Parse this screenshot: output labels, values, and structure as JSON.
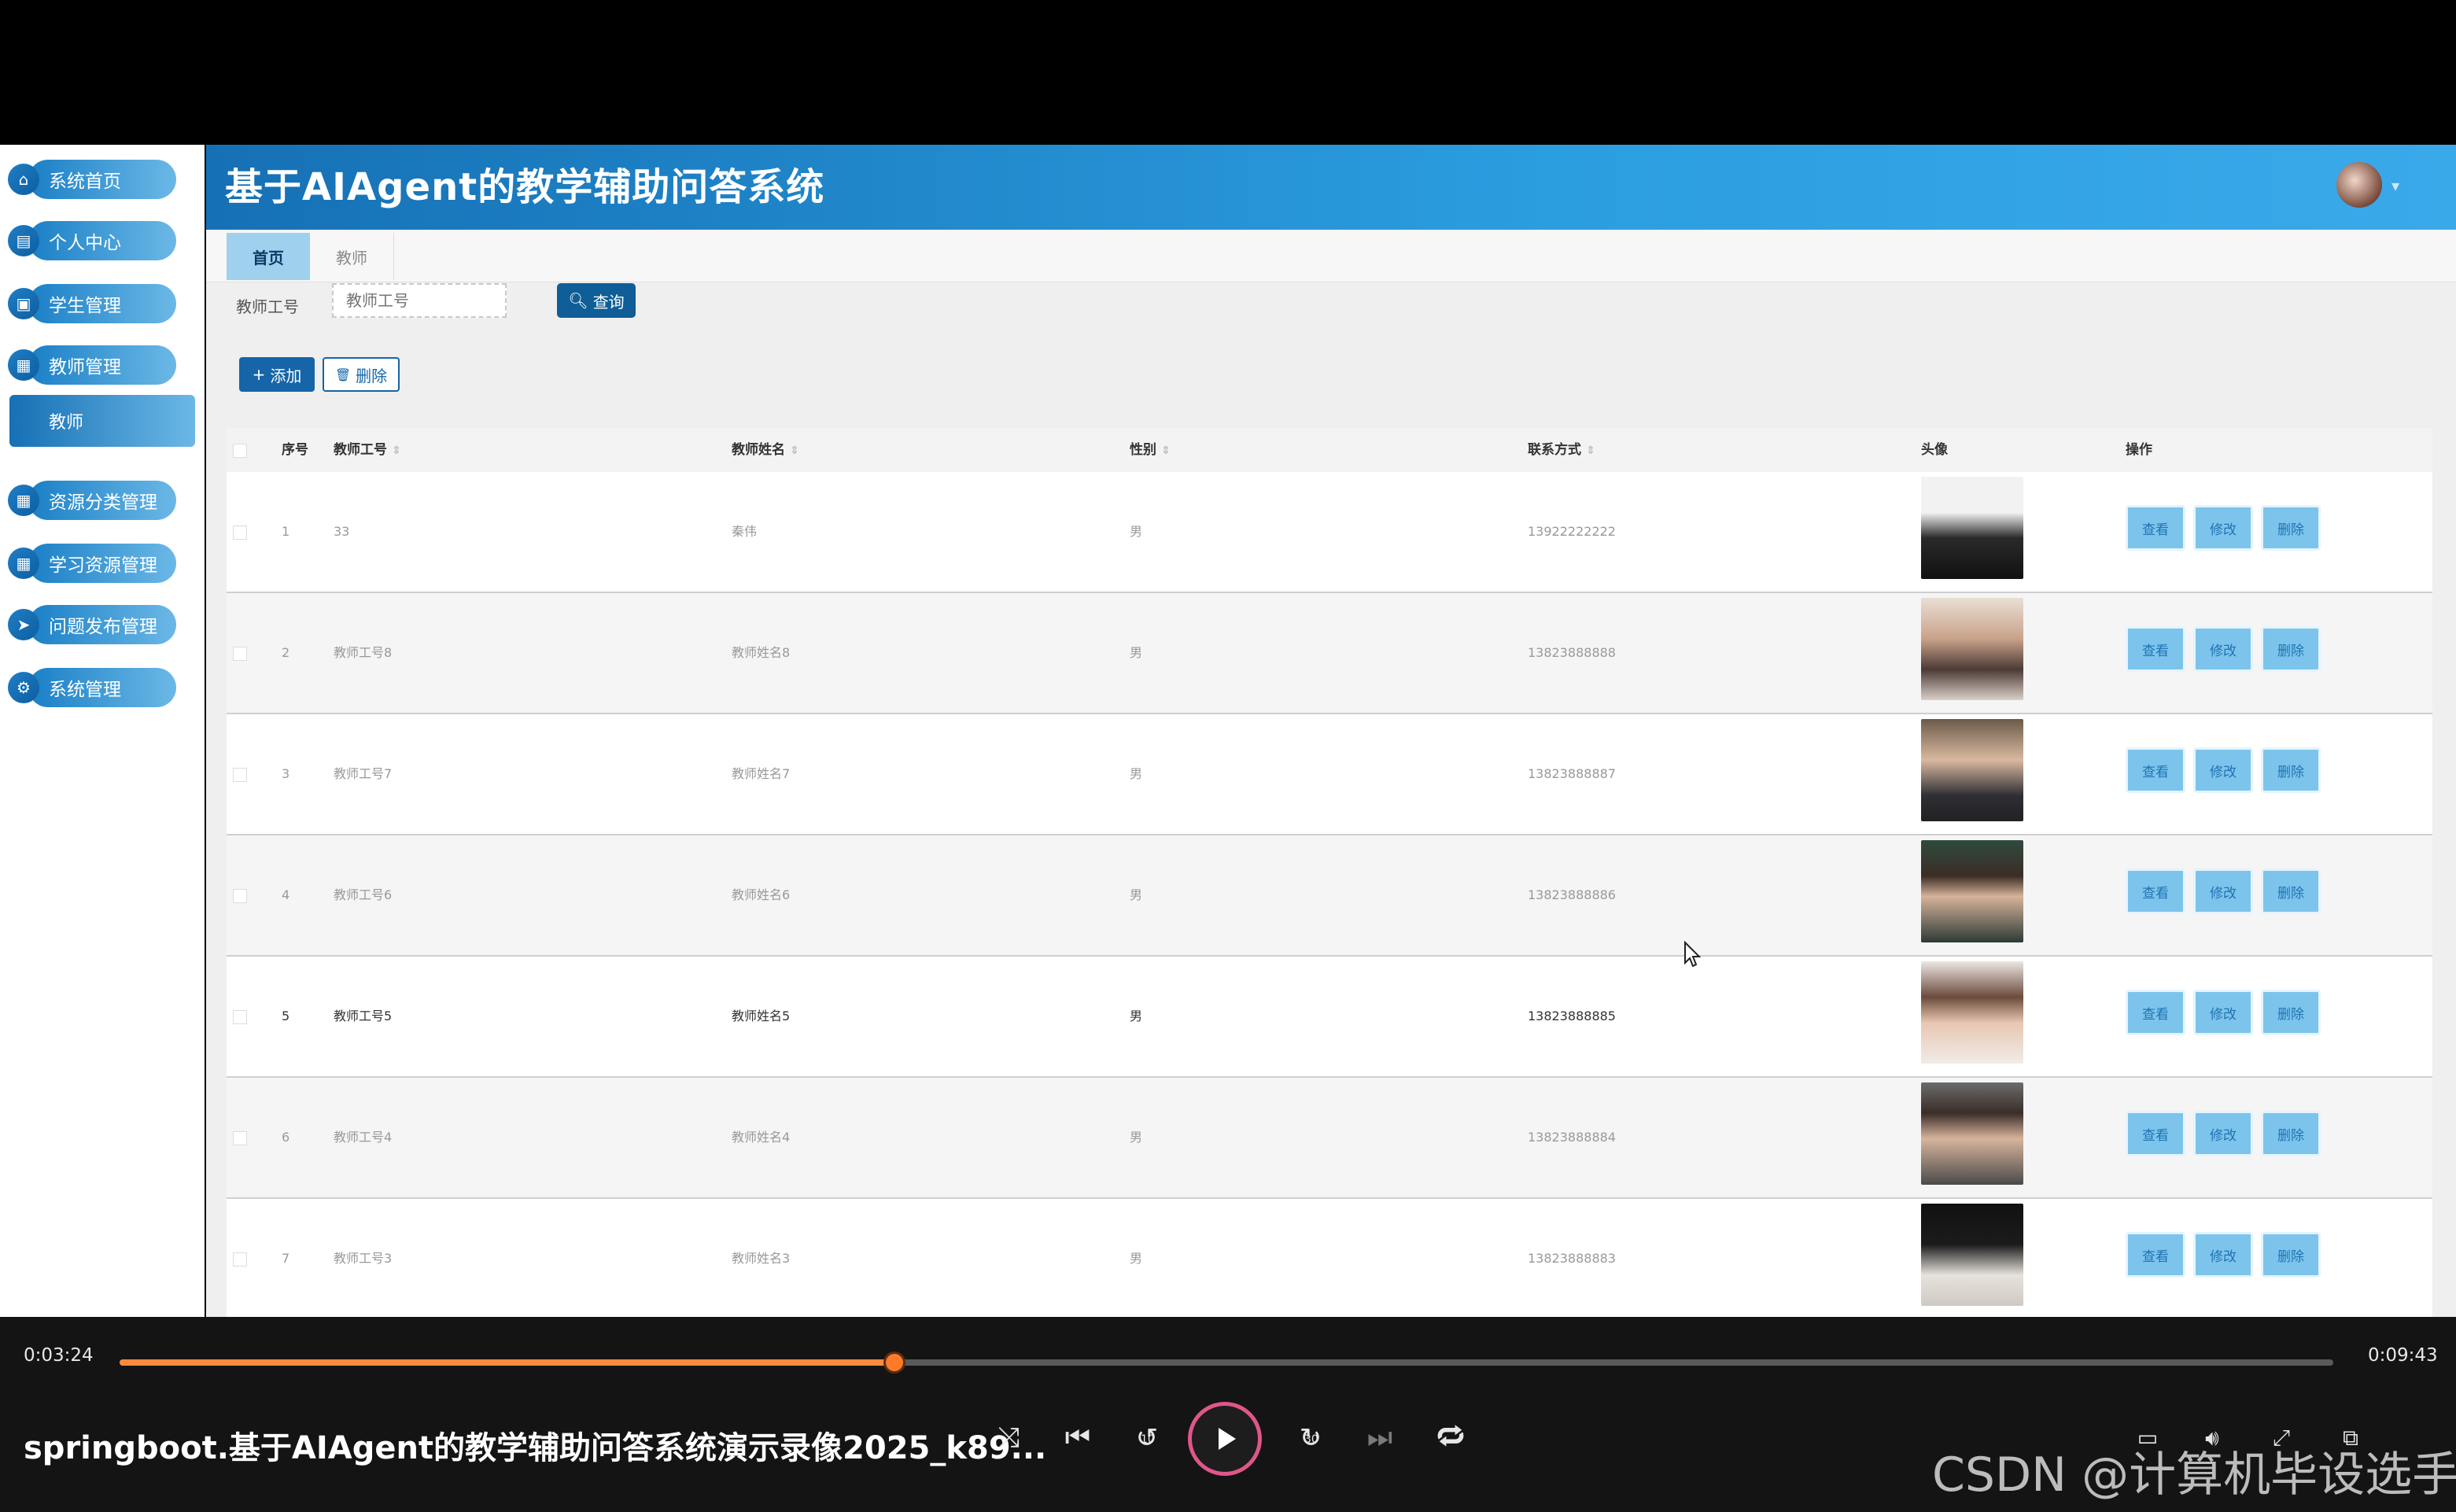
{
  "app": {
    "title": "基于AIAgent的教学辅助问答系统"
  },
  "sidebar": {
    "items": [
      {
        "label": "系统首页",
        "icon": "home-icon"
      },
      {
        "label": "个人中心",
        "icon": "user-card-icon"
      },
      {
        "label": "学生管理",
        "icon": "briefcase-icon"
      },
      {
        "label": "教师管理",
        "icon": "grid-icon"
      },
      {
        "label": "资源分类管理",
        "icon": "grid-icon"
      },
      {
        "label": "学习资源管理",
        "icon": "grid-icon"
      },
      {
        "label": "问题发布管理",
        "icon": "send-icon"
      },
      {
        "label": "系统管理",
        "icon": "settings-icon"
      }
    ],
    "active_sub": "教师"
  },
  "tabs": [
    {
      "label": "首页",
      "active": true
    },
    {
      "label": "教师",
      "active": false
    }
  ],
  "filter": {
    "label": "教师工号",
    "placeholder": "教师工号",
    "query_label": "查询"
  },
  "toolbar": {
    "add_label": "添加",
    "delete_label": "删除"
  },
  "table": {
    "columns": {
      "index": "序号",
      "teacher_id": "教师工号",
      "teacher_name": "教师姓名",
      "gender": "性别",
      "contact": "联系方式",
      "avatar": "头像",
      "actions": "操作"
    },
    "action_labels": {
      "view": "查看",
      "edit": "修改",
      "delete": "删除"
    },
    "rows": [
      {
        "index": "1",
        "teacher_id": "33",
        "teacher_name": "秦伟",
        "gender": "男",
        "contact": "13922222222"
      },
      {
        "index": "2",
        "teacher_id": "教师工号8",
        "teacher_name": "教师姓名8",
        "gender": "男",
        "contact": "13823888888"
      },
      {
        "index": "3",
        "teacher_id": "教师工号7",
        "teacher_name": "教师姓名7",
        "gender": "男",
        "contact": "13823888887"
      },
      {
        "index": "4",
        "teacher_id": "教师工号6",
        "teacher_name": "教师姓名6",
        "gender": "男",
        "contact": "13823888886"
      },
      {
        "index": "5",
        "teacher_id": "教师工号5",
        "teacher_name": "教师姓名5",
        "gender": "男",
        "contact": "13823888885"
      },
      {
        "index": "6",
        "teacher_id": "教师工号4",
        "teacher_name": "教师姓名4",
        "gender": "男",
        "contact": "13823888884"
      },
      {
        "index": "7",
        "teacher_id": "教师工号3",
        "teacher_name": "教师姓名3",
        "gender": "男",
        "contact": "13823888883"
      }
    ]
  },
  "player": {
    "current_time": "0:03:24",
    "total_time": "0:09:43",
    "progress": 0.35,
    "title": "springboot.基于AIAgent的教学辅助问答系统演示录像2025_k89...",
    "rewind_label": "10",
    "forward_label": "30"
  },
  "watermark": "CSDN @计算机毕设选手",
  "colors": {
    "header_start": "#1670b5",
    "header_end": "#3aa9ea",
    "accent": "#ff8a3d",
    "primary": "#1565a8"
  }
}
